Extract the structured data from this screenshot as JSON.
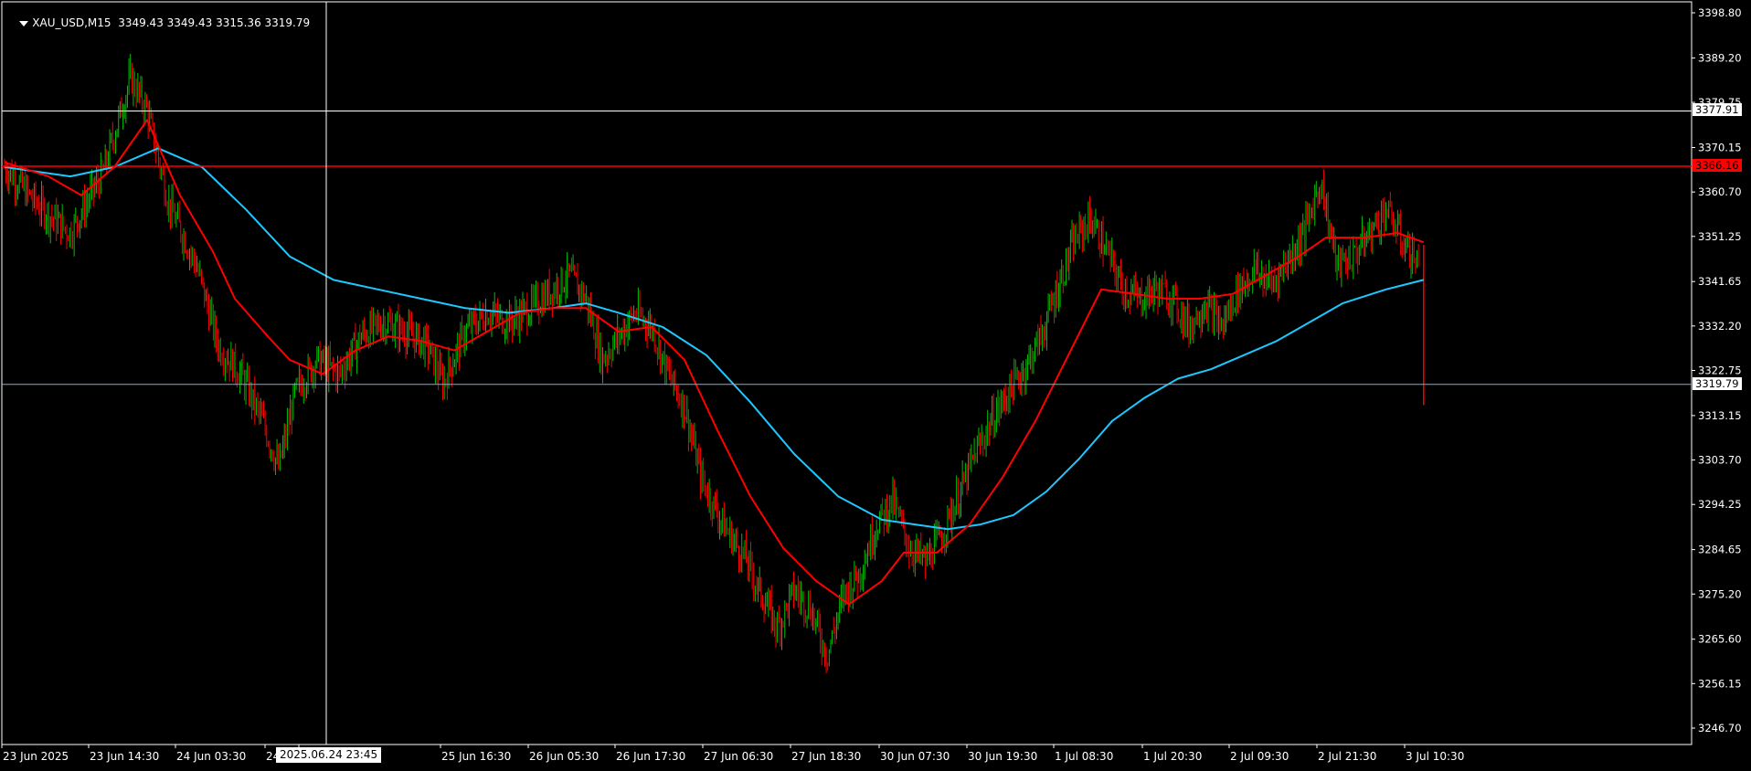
{
  "header": {
    "symbol_timeframe": "XAU_USD,M15",
    "ohlc": "3349.43 3349.43 3315.36 3319.79"
  },
  "colors": {
    "background": "#000000",
    "frame": "#ffffff",
    "bull_candle": "#00c000",
    "bear_candle": "#ff0000",
    "ma_fast": "#ff0000",
    "ma_slow": "#1ec8ff",
    "resistance_line": "#ff0000"
  },
  "price_axis": {
    "ticks": [
      "3398.80",
      "3389.20",
      "3379.75",
      "3370.15",
      "3360.70",
      "3351.25",
      "3341.65",
      "3332.20",
      "3322.75",
      "3313.15",
      "3303.70",
      "3294.25",
      "3284.65",
      "3275.20",
      "3265.60",
      "3256.15",
      "3246.70"
    ]
  },
  "time_axis": {
    "labels": [
      "23 Jun 2025",
      "23 Jun 14:30",
      "24 Jun 03:30",
      "24",
      "Jun 04:30",
      "25 Jun 16:30",
      "26 Jun 05:30",
      "26 Jun 17:30",
      "27 Jun 06:30",
      "27 Jun 18:30",
      "30 Jun 07:30",
      "30 Jun 19:30",
      "1 Jul 08:30",
      "1 Jul 20:30",
      "2 Jul 09:30",
      "2 Jul 21:30",
      "3 Jul 10:30"
    ]
  },
  "crosshair": {
    "price_label": "3377.91",
    "time_label": "2025.06.24 23:45"
  },
  "horizontal_lines": {
    "resistance_label": "3366.16",
    "current_label": "3319.79"
  },
  "chart_data": {
    "type": "line",
    "x_range": [
      "23 Jun 2025",
      "3 Jul 10:30"
    ],
    "y_range": [
      3246.7,
      3398.8
    ],
    "series": [],
    "price_path": [
      [
        0,
        3366
      ],
      [
        30,
        3358
      ],
      [
        60,
        3352
      ],
      [
        90,
        3365
      ],
      [
        115,
        3385
      ],
      [
        130,
        3378
      ],
      [
        150,
        3358
      ],
      [
        175,
        3345
      ],
      [
        195,
        3328
      ],
      [
        215,
        3322
      ],
      [
        235,
        3312
      ],
      [
        250,
        3302
      ],
      [
        265,
        3318
      ],
      [
        285,
        3325
      ],
      [
        305,
        3322
      ],
      [
        325,
        3330
      ],
      [
        345,
        3333
      ],
      [
        365,
        3331
      ],
      [
        385,
        3328
      ],
      [
        400,
        3320
      ],
      [
        420,
        3331
      ],
      [
        440,
        3335
      ],
      [
        460,
        3333
      ],
      [
        480,
        3336
      ],
      [
        500,
        3340
      ],
      [
        515,
        3343
      ],
      [
        530,
        3338
      ],
      [
        545,
        3325
      ],
      [
        560,
        3330
      ],
      [
        575,
        3335
      ],
      [
        590,
        3332
      ],
      [
        605,
        3322
      ],
      [
        620,
        3315
      ],
      [
        635,
        3300
      ],
      [
        655,
        3290
      ],
      [
        675,
        3283
      ],
      [
        690,
        3275
      ],
      [
        705,
        3268
      ],
      [
        720,
        3276
      ],
      [
        735,
        3272
      ],
      [
        750,
        3262
      ],
      [
        765,
        3275
      ],
      [
        780,
        3280
      ],
      [
        795,
        3290
      ],
      [
        810,
        3295
      ],
      [
        825,
        3285
      ],
      [
        840,
        3282
      ],
      [
        855,
        3288
      ],
      [
        870,
        3296
      ],
      [
        885,
        3305
      ],
      [
        900,
        3312
      ],
      [
        915,
        3318
      ],
      [
        930,
        3323
      ],
      [
        945,
        3330
      ],
      [
        960,
        3340
      ],
      [
        975,
        3350
      ],
      [
        990,
        3355
      ],
      [
        1005,
        3348
      ],
      [
        1020,
        3340
      ],
      [
        1035,
        3338
      ],
      [
        1050,
        3340
      ],
      [
        1065,
        3338
      ],
      [
        1080,
        3332
      ],
      [
        1095,
        3337
      ],
      [
        1110,
        3332
      ],
      [
        1125,
        3340
      ],
      [
        1140,
        3344
      ],
      [
        1155,
        3341
      ],
      [
        1170,
        3346
      ],
      [
        1185,
        3352
      ],
      [
        1200,
        3363
      ],
      [
        1215,
        3345
      ],
      [
        1230,
        3347
      ],
      [
        1245,
        3352
      ],
      [
        1260,
        3357
      ],
      [
        1275,
        3350
      ],
      [
        1290,
        3345
      ],
      [
        1294,
        3319.79
      ]
    ],
    "ma_fast": [
      [
        0,
        3367
      ],
      [
        40,
        3364
      ],
      [
        70,
        3360
      ],
      [
        100,
        3366
      ],
      [
        130,
        3376
      ],
      [
        160,
        3360
      ],
      [
        190,
        3348
      ],
      [
        210,
        3338
      ],
      [
        240,
        3330
      ],
      [
        260,
        3325
      ],
      [
        290,
        3322
      ],
      [
        320,
        3327
      ],
      [
        350,
        3330
      ],
      [
        380,
        3329
      ],
      [
        410,
        3327
      ],
      [
        440,
        3331
      ],
      [
        470,
        3335
      ],
      [
        500,
        3336
      ],
      [
        530,
        3336
      ],
      [
        560,
        3331
      ],
      [
        590,
        3332
      ],
      [
        620,
        3325
      ],
      [
        650,
        3310
      ],
      [
        680,
        3296
      ],
      [
        710,
        3285
      ],
      [
        740,
        3278
      ],
      [
        770,
        3273
      ],
      [
        800,
        3278
      ],
      [
        820,
        3284
      ],
      [
        850,
        3284
      ],
      [
        880,
        3290
      ],
      [
        910,
        3300
      ],
      [
        940,
        3312
      ],
      [
        970,
        3326
      ],
      [
        1000,
        3340
      ],
      [
        1030,
        3339
      ],
      [
        1060,
        3338
      ],
      [
        1090,
        3338
      ],
      [
        1120,
        3339
      ],
      [
        1150,
        3343
      ],
      [
        1180,
        3347
      ],
      [
        1205,
        3351
      ],
      [
        1240,
        3351
      ],
      [
        1270,
        3352
      ],
      [
        1294,
        3350
      ]
    ],
    "ma_slow": [
      [
        0,
        3366
      ],
      [
        60,
        3364
      ],
      [
        100,
        3366
      ],
      [
        140,
        3370
      ],
      [
        180,
        3366
      ],
      [
        220,
        3357
      ],
      [
        260,
        3347
      ],
      [
        300,
        3342
      ],
      [
        340,
        3340
      ],
      [
        380,
        3338
      ],
      [
        420,
        3336
      ],
      [
        460,
        3335
      ],
      [
        500,
        3336
      ],
      [
        530,
        3337
      ],
      [
        560,
        3335
      ],
      [
        600,
        3332
      ],
      [
        640,
        3326
      ],
      [
        680,
        3316
      ],
      [
        720,
        3305
      ],
      [
        760,
        3296
      ],
      [
        800,
        3291
      ],
      [
        830,
        3290
      ],
      [
        860,
        3289
      ],
      [
        890,
        3290
      ],
      [
        920,
        3292
      ],
      [
        950,
        3297
      ],
      [
        980,
        3304
      ],
      [
        1010,
        3312
      ],
      [
        1040,
        3317
      ],
      [
        1070,
        3321
      ],
      [
        1100,
        3323
      ],
      [
        1130,
        3326
      ],
      [
        1160,
        3329
      ],
      [
        1190,
        3333
      ],
      [
        1220,
        3337
      ],
      [
        1260,
        3340
      ],
      [
        1294,
        3342
      ]
    ]
  }
}
